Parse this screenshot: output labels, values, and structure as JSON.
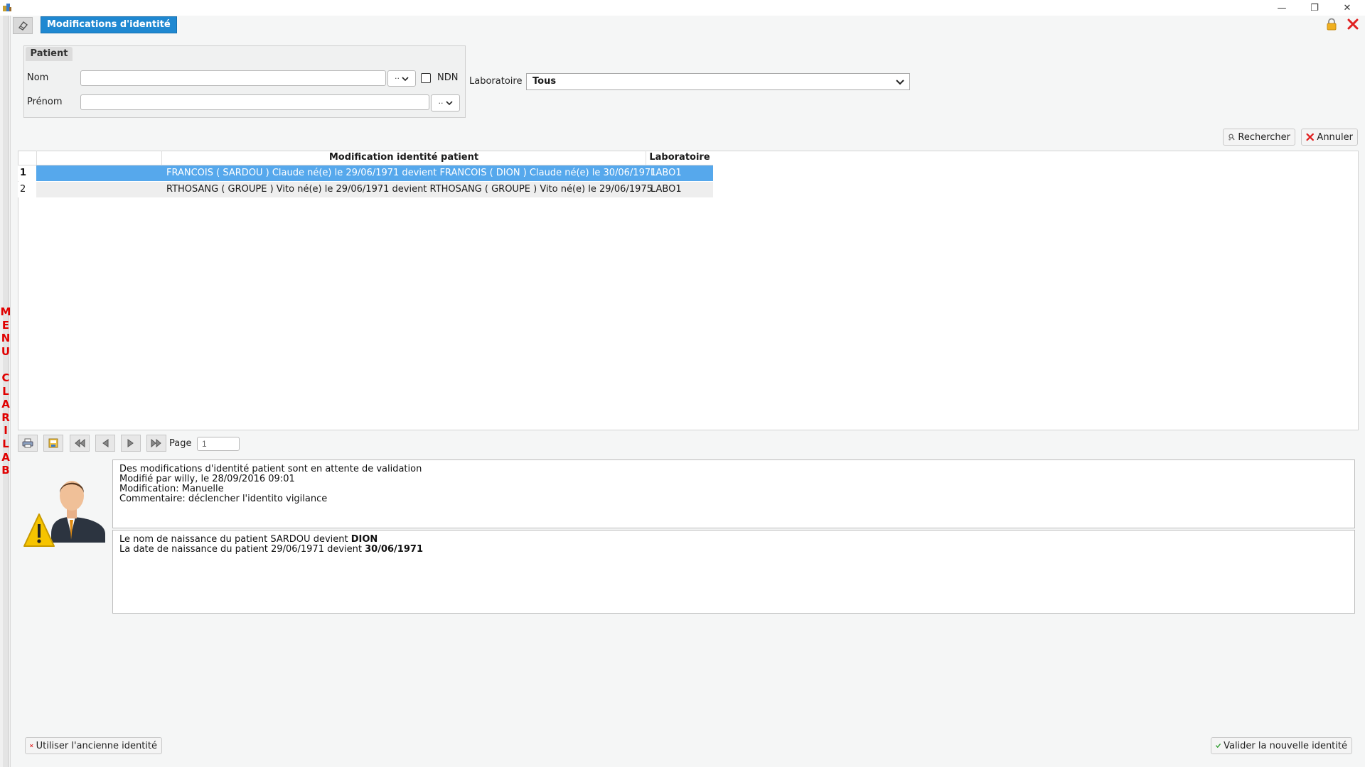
{
  "window": {
    "minimize_glyph": "—",
    "restore_glyph": "❐",
    "close_glyph": "✕"
  },
  "tab": {
    "title": "Modifications d'identité"
  },
  "side_menu": {
    "letters": [
      "M",
      "E",
      "N",
      "U",
      "",
      "C",
      "L",
      "A",
      "R",
      "I",
      "L",
      "A",
      "B"
    ]
  },
  "filters": {
    "group_label": "Patient",
    "nom_label": "Nom",
    "nom_value": "",
    "nom_operator": "..",
    "ndn_label": "NDN",
    "ndn_checked": false,
    "prenom_label": "Prénom",
    "prenom_value": "",
    "prenom_operator": "..",
    "laboratoire_label": "Laboratoire",
    "laboratoire_value": "Tous"
  },
  "actions": {
    "search_label": "Rechercher",
    "cancel_label": "Annuler"
  },
  "grid": {
    "columns": [
      "",
      "Modification identité patient",
      "Laboratoire"
    ],
    "rows": [
      {
        "num": "1",
        "modification": "FRANCOIS ( SARDOU ) Claude né(e) le 29/06/1971 devient FRANCOIS ( DION ) Claude né(e) le 30/06/1971",
        "laboratoire": "LABO1",
        "selected": true
      },
      {
        "num": "2",
        "modification": "RTHOSANG ( GROUPE ) Vito né(e) le 29/06/1971 devient RTHOSANG ( GROUPE ) Vito né(e) le 29/06/1975",
        "laboratoire": "LABO1",
        "selected": false
      }
    ]
  },
  "pager": {
    "page_label": "Page",
    "page_value": "1"
  },
  "message": {
    "lines": [
      "Des modifications d'identité patient sont en attente de validation",
      "Modifié par willy, le 28/09/2016 09:01",
      "Modification: Manuelle",
      "Commentaire: déclencher l'identito vigilance"
    ],
    "detail_1_prefix": "Le nom de naissance du patient SARDOU devient ",
    "detail_1_value": "DION",
    "detail_2_prefix": "La date de naissance du patient 29/06/1971 devient ",
    "detail_2_value": "30/06/1971"
  },
  "footer": {
    "use_old_label": "Utiliser l'ancienne identité",
    "validate_new_label": "Valider la nouvelle identité"
  },
  "colors": {
    "accent": "#1f88d1",
    "selected_row": "#56a8ec",
    "alt_row": "#eeeeee",
    "menu_red": "#e00000",
    "cancel_red": "#e02020",
    "validate_green": "#2a9a2a"
  }
}
